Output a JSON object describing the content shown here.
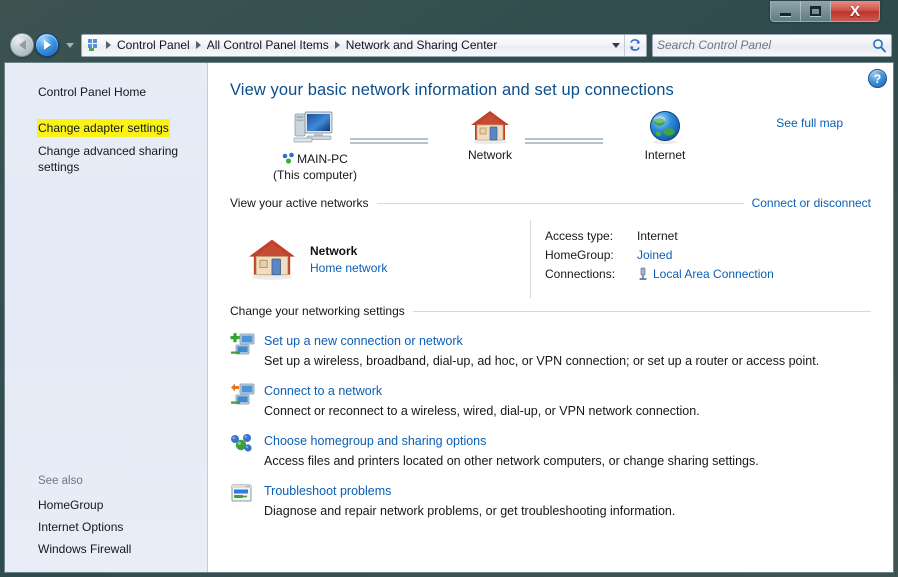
{
  "window": {
    "controls": {
      "minimize_label": "Minimize",
      "maximize_label": "Maximize",
      "close_label": "X"
    }
  },
  "nav": {
    "back_label": "Back",
    "forward_label": "Forward",
    "recent_label": "Recent pages",
    "refresh_label": "Refresh",
    "address_dropdown_label": "Previous locations"
  },
  "breadcrumb": {
    "icon": "control-panel-icon",
    "items": [
      {
        "label": "Control Panel"
      },
      {
        "label": "All Control Panel Items"
      },
      {
        "label": "Network and Sharing Center"
      }
    ]
  },
  "search": {
    "placeholder": "Search Control Panel",
    "value": "",
    "icon": "search-icon"
  },
  "sidebar": {
    "home": "Control Panel Home",
    "links": [
      {
        "label": "Change adapter settings",
        "highlighted": true
      },
      {
        "label": "Change advanced sharing settings",
        "highlighted": false
      }
    ],
    "see_also_title": "See also",
    "see_also": [
      {
        "label": "HomeGroup"
      },
      {
        "label": "Internet Options"
      },
      {
        "label": "Windows Firewall"
      }
    ]
  },
  "content": {
    "help_label": "?",
    "title": "View your basic network information and set up connections",
    "map": {
      "see_full_map": "See full map",
      "nodes": [
        {
          "icon": "computer-icon",
          "label": "MAIN-PC",
          "sublabel": "(This computer)",
          "badge": "network-badge-icon"
        },
        {
          "icon": "home-network-icon",
          "label": "Network",
          "sublabel": ""
        },
        {
          "icon": "internet-globe-icon",
          "label": "Internet",
          "sublabel": ""
        }
      ]
    },
    "active_networks": {
      "heading": "View your active networks",
      "action_link": "Connect or disconnect",
      "network": {
        "icon": "home-network-icon",
        "name": "Network",
        "type": "Home network"
      },
      "details": [
        {
          "label": "Access type:",
          "value": "Internet",
          "is_link": false,
          "icon": ""
        },
        {
          "label": "HomeGroup:",
          "value": "Joined",
          "is_link": true,
          "icon": ""
        },
        {
          "label": "Connections:",
          "value": "Local Area Connection",
          "is_link": true,
          "icon": "lan-adapter-icon"
        }
      ]
    },
    "settings": {
      "heading": "Change your networking settings",
      "items": [
        {
          "icon": "new-connection-icon",
          "link": "Set up a new connection or network",
          "desc": "Set up a wireless, broadband, dial-up, ad hoc, or VPN connection; or set up a router or access point."
        },
        {
          "icon": "connect-network-icon",
          "link": "Connect to a network",
          "desc": "Connect or reconnect to a wireless, wired, dial-up, or VPN network connection."
        },
        {
          "icon": "homegroup-icon",
          "link": "Choose homegroup and sharing options",
          "desc": "Access files and printers located on other network computers, or change sharing settings."
        },
        {
          "icon": "troubleshoot-icon",
          "link": "Troubleshoot problems",
          "desc": "Diagnose and repair network problems, or get troubleshooting information."
        }
      ]
    }
  },
  "colors": {
    "link": "#0b5fb5",
    "title": "#0b4e8a",
    "highlight": "#fbf318",
    "sidebar_bg": "#e4eaf6",
    "close_button": "#c0392b"
  }
}
